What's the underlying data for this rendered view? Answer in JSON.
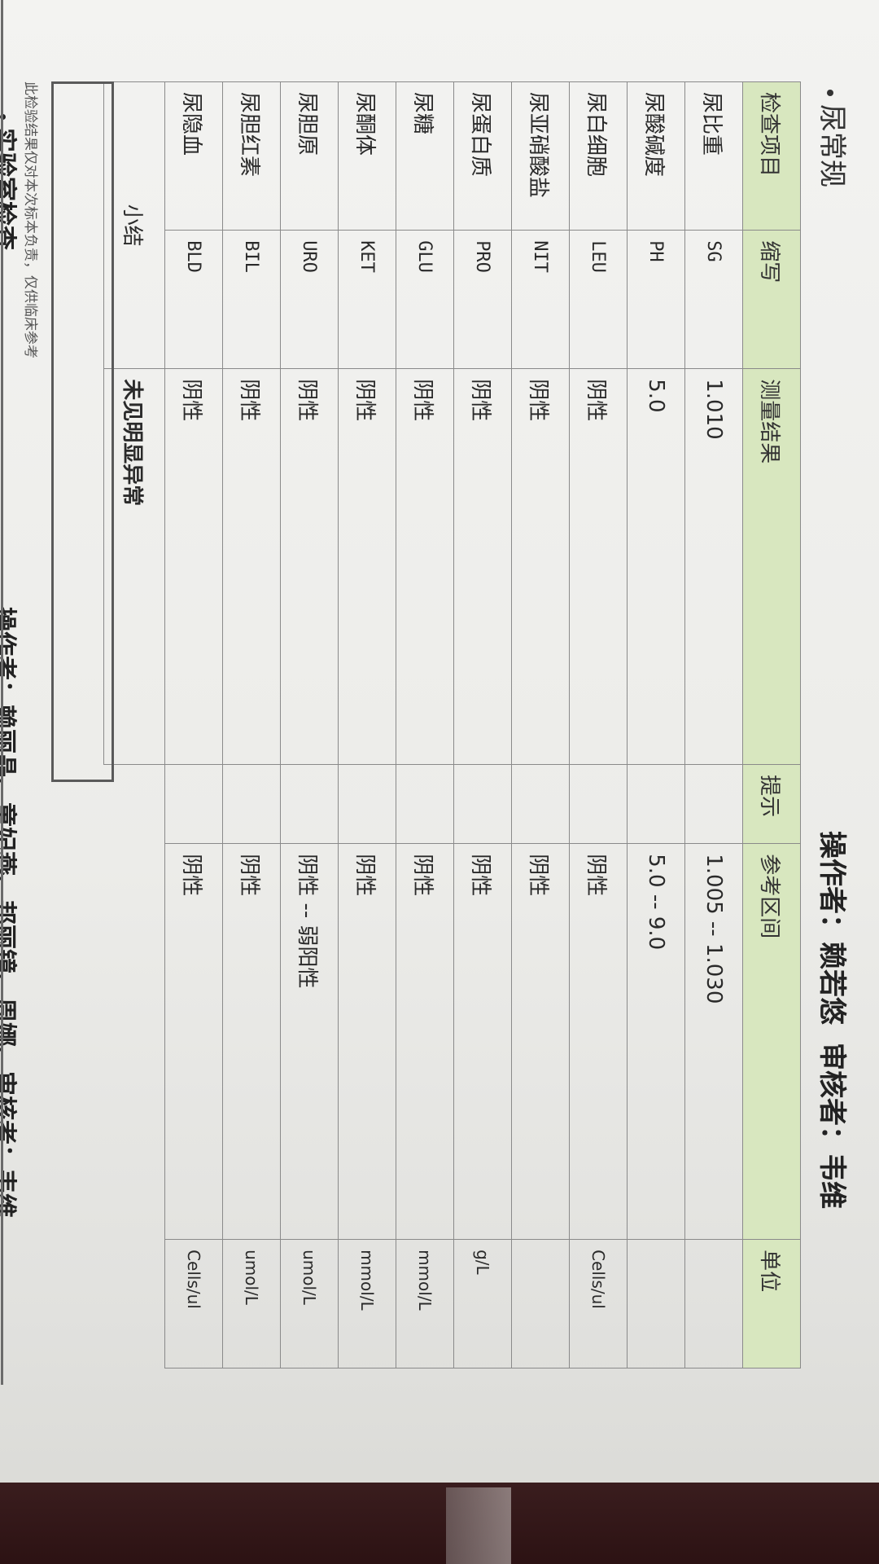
{
  "section": {
    "title": "尿常规"
  },
  "header": {
    "operator": "操作者：赖若悠",
    "reviewer": "审核者：韦维"
  },
  "table": {
    "columns": [
      "检查项目",
      "缩写",
      "测量结果",
      "提示",
      "参考区间",
      "单位"
    ],
    "rows": [
      {
        "item": "尿比重",
        "abbr": "SG",
        "result": "1.010",
        "hint": "",
        "range": "1.005 -- 1.030",
        "unit": ""
      },
      {
        "item": "尿酸碱度",
        "abbr": "PH",
        "result": "5.0",
        "hint": "",
        "range": "5.0 -- 9.0",
        "unit": ""
      },
      {
        "item": "尿白细胞",
        "abbr": "LEU",
        "result": "阴性",
        "hint": "",
        "range": "阴性",
        "unit": "Cells/ul"
      },
      {
        "item": "尿亚硝酸盐",
        "abbr": "NIT",
        "result": "阴性",
        "hint": "",
        "range": "阴性",
        "unit": ""
      },
      {
        "item": "尿蛋白质",
        "abbr": "PRO",
        "result": "阴性",
        "hint": "",
        "range": "阴性",
        "unit": "g/L"
      },
      {
        "item": "尿糖",
        "abbr": "GLU",
        "result": "阴性",
        "hint": "",
        "range": "阴性",
        "unit": "mmol/L"
      },
      {
        "item": "尿酮体",
        "abbr": "KET",
        "result": "阴性",
        "hint": "",
        "range": "阴性",
        "unit": "mmol/L"
      },
      {
        "item": "尿胆原",
        "abbr": "URO",
        "result": "阴性",
        "hint": "",
        "range": "阴性 -- 弱阳性",
        "unit": "umol/L"
      },
      {
        "item": "尿胆红素",
        "abbr": "BIL",
        "result": "阴性",
        "hint": "",
        "range": "阴性",
        "unit": "umol/L"
      },
      {
        "item": "尿隐血",
        "abbr": "BLD",
        "result": "阴性",
        "hint": "",
        "range": "阴性",
        "unit": "Cells/ul"
      }
    ],
    "summary_label": "小结",
    "summary_value": "未见明显异常"
  },
  "disclaimer": "此检验结果仅对本次标本负责，仅供临床参考",
  "next_section": {
    "title": "实验室检查",
    "operator": "操作者：赖丽晶、童妃燕、邦丽镜、周娜、审核者：韦维"
  }
}
